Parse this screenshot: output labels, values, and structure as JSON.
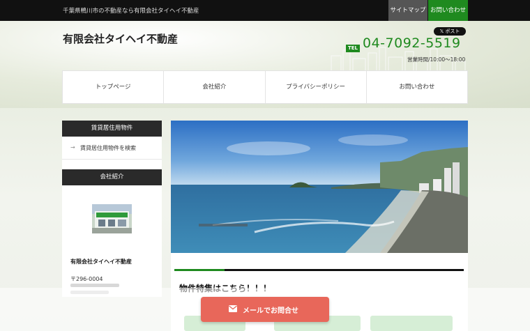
{
  "topbar": {
    "tagline": "千葉県鴨川市の不動産なら有限会社タイヘイ不動産",
    "sitemap_label": "サイトマップ",
    "contact_label": "お問い合わせ"
  },
  "header": {
    "logo_text": "有限会社タイヘイ不動産",
    "x_post_label": "ポスト",
    "tel_badge": "TEL",
    "tel_number": "04-7092-5519",
    "hours": "営業時間/10:00～18:00"
  },
  "nav": {
    "items": [
      {
        "label": "トップページ"
      },
      {
        "label": "会社紹介"
      },
      {
        "label": "プライバシーポリシー"
      },
      {
        "label": "お問い合わせ"
      }
    ]
  },
  "sidebar": {
    "rental_heading": "賃貸居住用物件",
    "rental_link": "賃貸居住用物件を検索",
    "company_heading": "会社紹介",
    "company_name": "有限会社タイヘイ不動産",
    "company_zip": "〒296-0004"
  },
  "main": {
    "feature_title": "物件特集はこちら！！！"
  },
  "footer_cta": {
    "mail_button": "メールでお問合せ"
  },
  "colors": {
    "accent_green": "#1f8a1f",
    "cta_red": "#e8675a",
    "dark": "#111111"
  }
}
